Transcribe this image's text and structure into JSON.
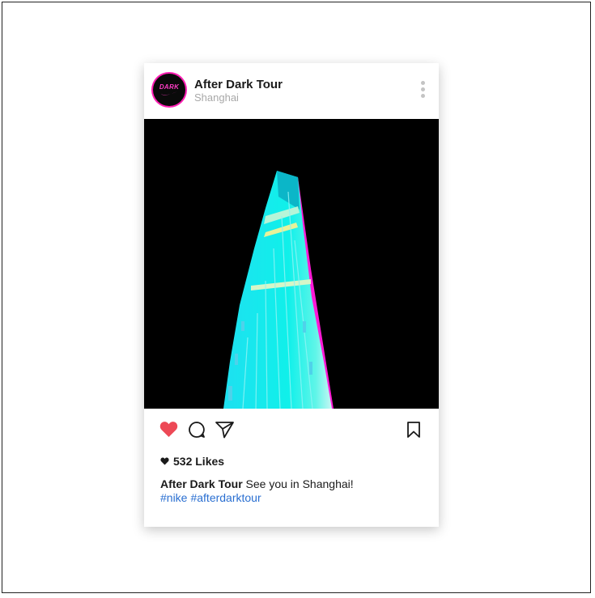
{
  "post": {
    "account_name": "After Dark Tour",
    "location": "Shanghai",
    "avatar_text": "DARK",
    "likes_count": "532",
    "likes_label": "Likes",
    "caption_user": "After Dark Tour",
    "caption_text": "See you in Shanghai!",
    "hashtags": [
      "#nike",
      "#afterdarktour"
    ],
    "liked": true
  },
  "icons": {
    "more": "more-options-icon",
    "like": "heart-icon",
    "comment": "comment-icon",
    "share": "send-icon",
    "save": "bookmark-icon"
  },
  "colors": {
    "accent_pink": "#ff1fb4",
    "like_red": "#ed4956",
    "hashtag_blue": "#2a6fd1",
    "tower_cyan": "#12e6ee",
    "tower_magenta": "#ff19d6"
  }
}
